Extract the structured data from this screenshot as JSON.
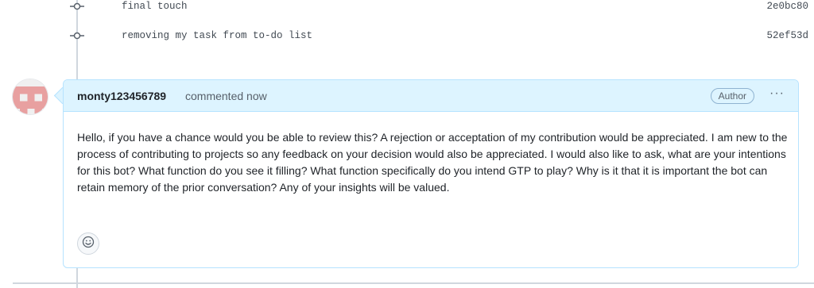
{
  "commits": [
    {
      "message": "final touch",
      "sha": "2e0bc80"
    },
    {
      "message": "removing my task from to-do list",
      "sha": "52ef53d"
    }
  ],
  "comment": {
    "author": "monty123456789",
    "action": "commented now",
    "badge": "Author",
    "more_label": "···",
    "body": "Hello, if you have a chance would you be able to review this? A rejection or acceptation of my contribution would be appreciated. I am new to the process of contributing to projects so any feedback on your decision would also be appreciated. I would also like to ask, what are your intentions for this bot? What function do you see it filling? What function specifically do you intend GTP to play? Why is it that it is important the bot can retain memory of the prior conversation? Any of your insights will be valued.",
    "reaction_icon": "smiley-icon"
  },
  "colors": {
    "header_bg": "#ddf4ff",
    "border": "#b6e3ff",
    "avatar_pink": "#e8a0a0"
  }
}
